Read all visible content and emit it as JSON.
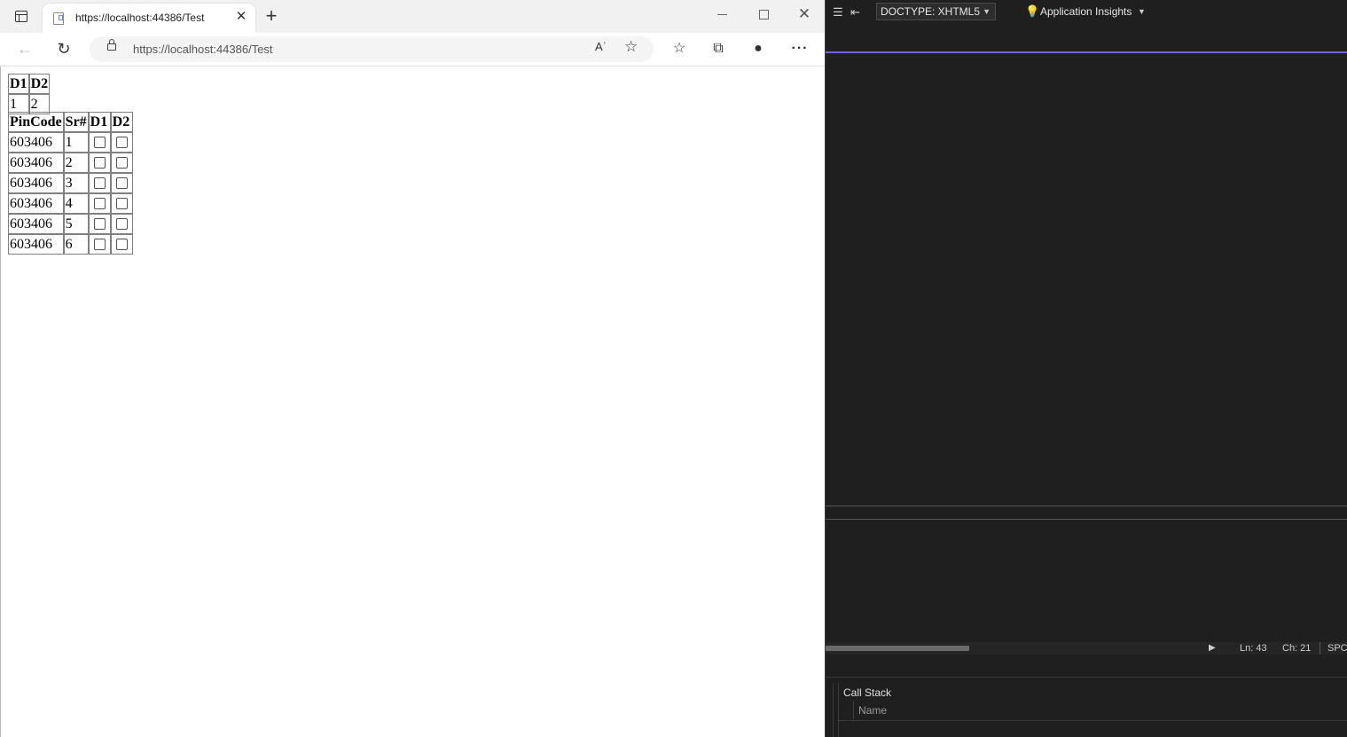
{
  "browser": {
    "tab_title": "https://localhost:44386/Test",
    "url": "https://localhost:44386/Test",
    "read_aloud_label": "Aʾ"
  },
  "table1": {
    "headers": [
      "D1",
      "D2"
    ],
    "row": [
      "1",
      "2"
    ]
  },
  "table2": {
    "headers": [
      "PinCode",
      "Sr#",
      "D1",
      "D2"
    ],
    "rows": [
      {
        "pincode": "603406",
        "sr": "1"
      },
      {
        "pincode": "603406",
        "sr": "2"
      },
      {
        "pincode": "603406",
        "sr": "3"
      },
      {
        "pincode": "603406",
        "sr": "4"
      },
      {
        "pincode": "603406",
        "sr": "5"
      },
      {
        "pincode": "603406",
        "sr": "6"
      }
    ]
  },
  "ide": {
    "doctype": "DOCTYPE: XHTML5",
    "app_insights": "Application Insights",
    "status": {
      "ln": "Ln: 43",
      "ch": "Ch: 21",
      "spc": "SPC"
    },
    "callstack": {
      "title": "Call Stack",
      "column": "Name"
    },
    "accent_color": "#7160e8"
  }
}
